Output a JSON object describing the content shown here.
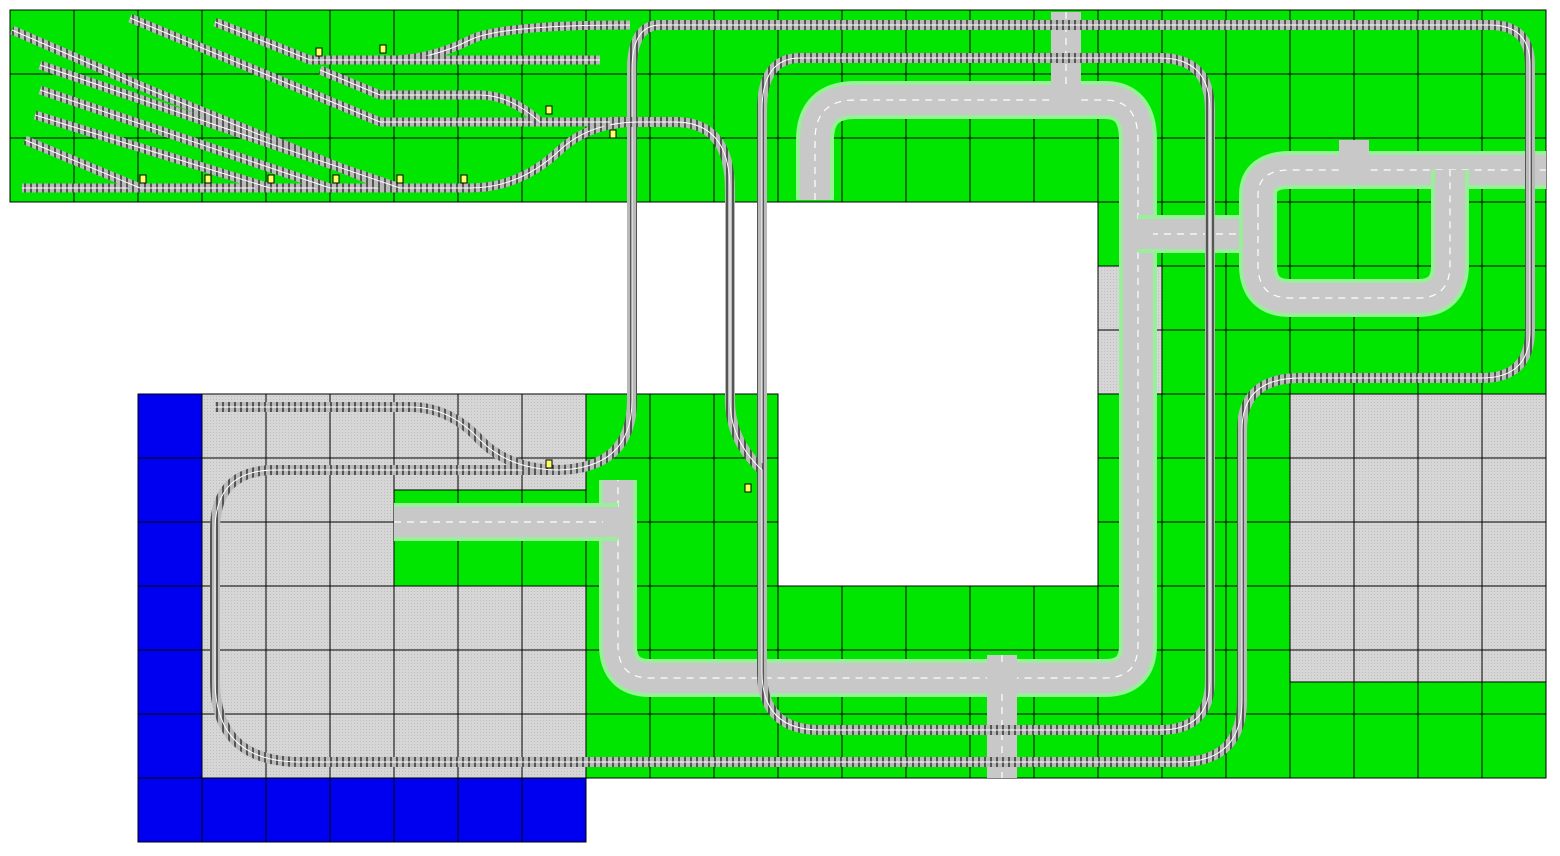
{
  "colors": {
    "grass": "#00e600",
    "baseplate": "#d2d2d2",
    "water": "#0000f0",
    "road": "#c8c8c8",
    "road_border": "#98f098",
    "road_dash": "#ffffff",
    "track_sleeper": "#555555",
    "track_bed": "#b9b9b9",
    "signal": "#ffff66",
    "grid": "#000000"
  },
  "icons": {
    "track": "railway-track-icon",
    "switch": "track-switch-icon",
    "signal": "signal-light-icon",
    "crossing": "road-crossing-icon"
  },
  "layout_name": ""
}
